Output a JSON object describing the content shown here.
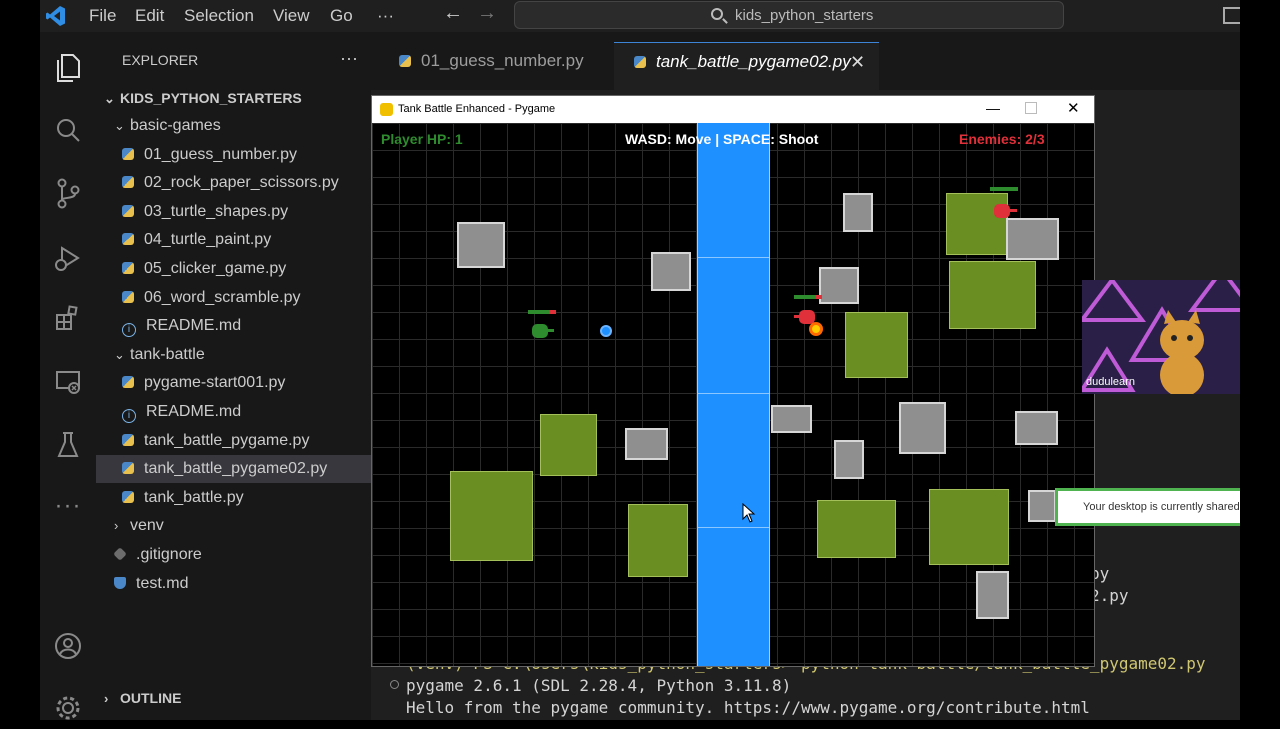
{
  "titlebar": {
    "menu": [
      "File",
      "Edit",
      "Selection",
      "View",
      "Go",
      "···"
    ],
    "search_text": "kids_python_starters"
  },
  "activity_icons": [
    "files-icon",
    "search-icon",
    "source-control-icon",
    "run-debug-icon",
    "extensions-icon",
    "remote-explorer-icon",
    "testing-icon",
    "more-icon",
    "account-icon",
    "settings-icon"
  ],
  "sidebar": {
    "header": "EXPLORER",
    "more": "···",
    "root": "KIDS_PYTHON_STARTERS",
    "items": [
      {
        "label": "basic-games",
        "kind": "folder-open",
        "indent": 1
      },
      {
        "label": "01_guess_number.py",
        "kind": "py",
        "indent": 2
      },
      {
        "label": "02_rock_paper_scissors.py",
        "kind": "py",
        "indent": 2
      },
      {
        "label": "03_turtle_shapes.py",
        "kind": "py",
        "indent": 2
      },
      {
        "label": "04_turtle_paint.py",
        "kind": "py",
        "indent": 2
      },
      {
        "label": "05_clicker_game.py",
        "kind": "py",
        "indent": 2
      },
      {
        "label": "06_word_scramble.py",
        "kind": "py",
        "indent": 2
      },
      {
        "label": "README.md",
        "kind": "info",
        "indent": 2
      },
      {
        "label": "tank-battle",
        "kind": "folder-open",
        "indent": 1
      },
      {
        "label": "pygame-start001.py",
        "kind": "py",
        "indent": 2
      },
      {
        "label": "README.md",
        "kind": "info",
        "indent": 2
      },
      {
        "label": "tank_battle_pygame.py",
        "kind": "py",
        "indent": 2
      },
      {
        "label": "tank_battle_pygame02.py",
        "kind": "py",
        "indent": 2,
        "selected": true
      },
      {
        "label": "tank_battle.py",
        "kind": "py",
        "indent": 2
      },
      {
        "label": "venv",
        "kind": "folder-closed",
        "indent": 1
      },
      {
        "label": ".gitignore",
        "kind": "git",
        "indent": 1
      },
      {
        "label": "test.md",
        "kind": "md",
        "indent": 1
      }
    ],
    "outline": "OUTLINE"
  },
  "tabs": [
    {
      "label": "01_guess_number.py",
      "active": false
    },
    {
      "label": "tank_battle_pygame02.py",
      "active": true
    }
  ],
  "pygame": {
    "window_title": "Tank Battle Enhanced - Pygame",
    "hud_player": "Player HP: 1",
    "hud_controls": "WASD: Move | SPACE: Shoot",
    "hud_enemies": "Enemies: 2/3",
    "colors": {
      "player": "#2e8b2e",
      "enemy": "#e0303a",
      "river": "#1e90ff",
      "bush": "#6b8e23",
      "wall": "#8f8f8f"
    }
  },
  "terminal": {
    "partial_1": "py",
    "partial_2": "2.py",
    "command_line": "(venv) PS C:\\Users\\kids_python_starters> python tank-battle/tank_battle_pygame02.py",
    "line_2": "pygame 2.6.1 (SDL 2.28.4, Python 3.11.8)",
    "line_3": "Hello from the pygame community. https://www.pygame.org/contribute.html"
  },
  "webcam": {
    "name": "dudulearn"
  },
  "toast": {
    "text": "Your desktop is currently shared"
  }
}
